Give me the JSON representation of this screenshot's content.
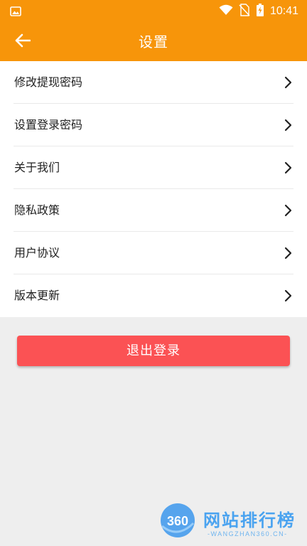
{
  "status_bar": {
    "time": "10:41",
    "left_icon": "image-icon",
    "icons": [
      "wifi-icon",
      "no-sim-icon",
      "battery-charging-icon"
    ]
  },
  "app_bar": {
    "back_icon": "arrow-left-icon",
    "title": "设置"
  },
  "menu": {
    "items": [
      {
        "label": "修改提现密码"
      },
      {
        "label": "设置登录密码"
      },
      {
        "label": "关于我们"
      },
      {
        "label": "隐私政策"
      },
      {
        "label": "用户协议"
      },
      {
        "label": "版本更新"
      }
    ]
  },
  "logout": {
    "label": "退出登录"
  },
  "watermark": {
    "logo_text": "360",
    "title": "网站排行榜",
    "subtitle": "-WANGZHAN360.CN-"
  },
  "colors": {
    "accent": "#f7950a",
    "logout": "#fb5254",
    "background": "#eeeeee"
  }
}
